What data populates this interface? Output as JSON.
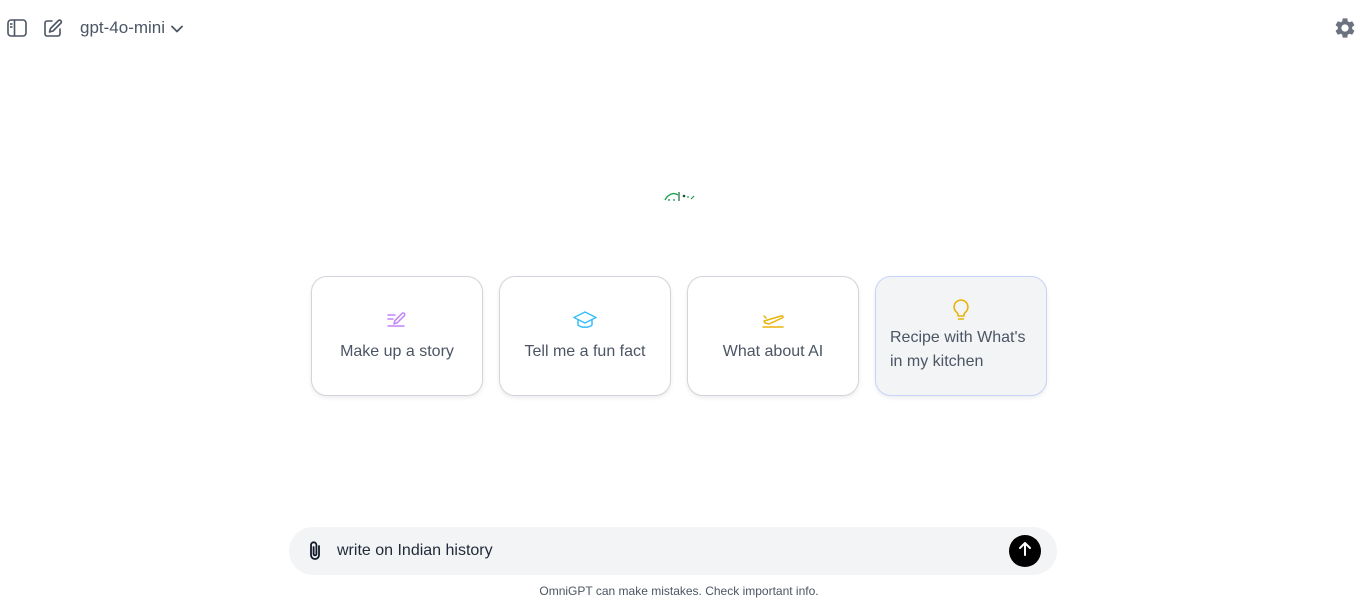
{
  "header": {
    "sidebar_icon": "sidebar-toggle-icon",
    "new_chat_icon": "edit-icon",
    "model_name": "gpt-4o-mini",
    "model_dropdown_icon": "chevron-down-icon",
    "settings_icon": "gear-icon"
  },
  "logo_icon": "app-logo-icon",
  "suggestions": [
    {
      "label": "Make up a story",
      "icon": "pencil-icon",
      "color": "#c084fc"
    },
    {
      "label": "Tell me a fun fact",
      "icon": "graduation-cap-icon",
      "color": "#38bdf8"
    },
    {
      "label": "What about AI",
      "icon": "airplane-icon",
      "color": "#eab308"
    },
    {
      "label": "Recipe with What's in my kitchen",
      "icon": "lightbulb-icon",
      "color": "#eab308"
    }
  ],
  "composer": {
    "value": "write on Indian history",
    "attach_icon": "paperclip-icon",
    "send_icon": "arrow-up-icon"
  },
  "footer": {
    "disclaimer": "OmniGPT can make mistakes. Check important info."
  }
}
